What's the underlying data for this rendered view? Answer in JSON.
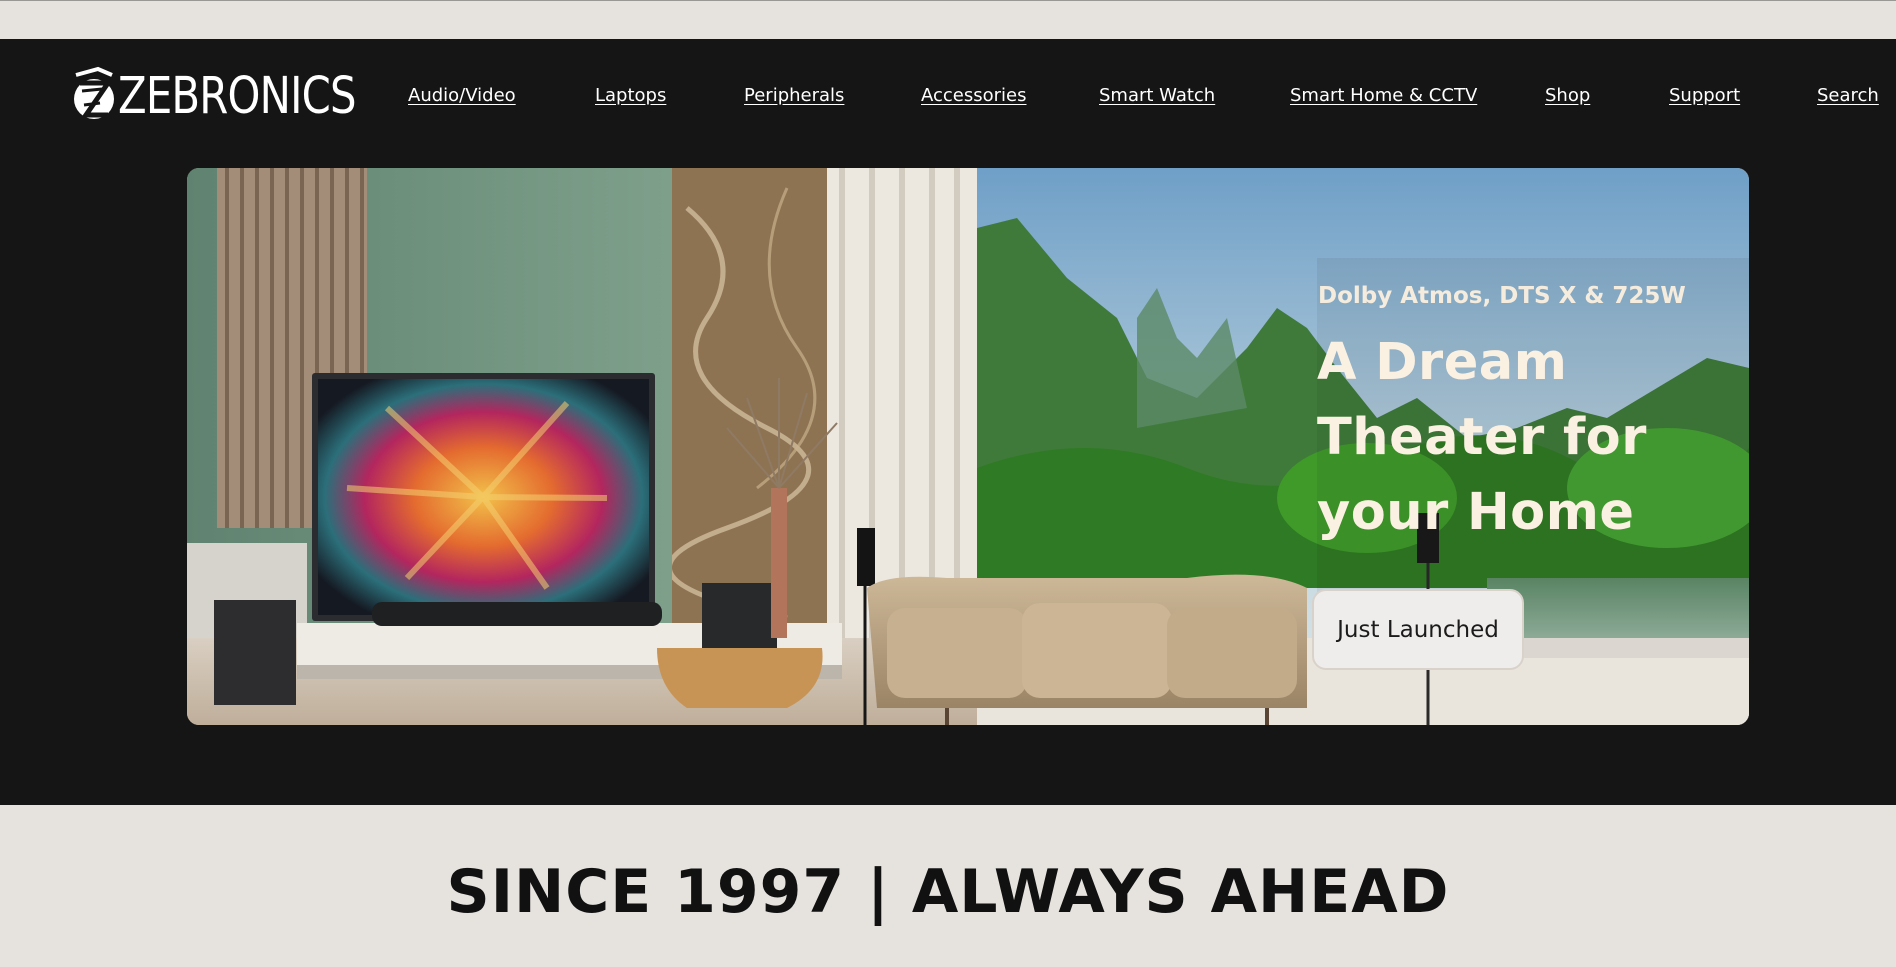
{
  "brand": {
    "name": "ZEBRONICS",
    "logo_icon": "zebronics-z-mark"
  },
  "nav": {
    "items": [
      {
        "label": "Audio/Video"
      },
      {
        "label": "Laptops"
      },
      {
        "label": "Peripherals"
      },
      {
        "label": "Accessories"
      },
      {
        "label": "Smart Watch"
      },
      {
        "label": "Smart Home & CCTV"
      },
      {
        "label": "Shop"
      },
      {
        "label": "Support"
      },
      {
        "label": "Search"
      }
    ]
  },
  "hero": {
    "subtitle": "Dolby Atmos, DTS X & 725W",
    "title": "A Dream Theater for your Home",
    "cta_label": "Just Launched"
  },
  "tagline": "SINCE 1997 | ALWAYS AHEAD",
  "colors": {
    "header_bg": "#151515",
    "page_bg": "#e6e3df",
    "hero_text": "#fbf1e2",
    "cta_bg": "#efedeb"
  }
}
